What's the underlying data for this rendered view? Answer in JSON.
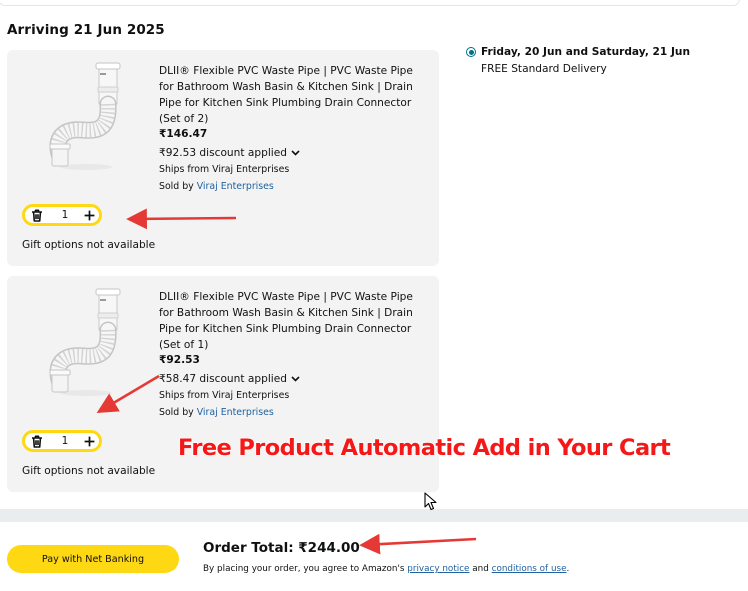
{
  "heading": "Arriving 21 Jun 2025",
  "items": [
    {
      "title": "DLII® Flexible PVC Waste Pipe | PVC Waste Pipe for Bathroom Wash Basin & Kitchen Sink | Drain Pipe for Kitchen Sink Plumbing Drain Connector (Set of 2)",
      "price": "₹146.47",
      "discount": "₹92.53 discount applied",
      "ships_from": "Ships from Viraj Enterprises",
      "sold_by_prefix": "Sold by ",
      "seller": "Viraj Enterprises",
      "quantity": "1",
      "gift": "Gift options not available"
    },
    {
      "title": "DLII® Flexible PVC Waste Pipe | PVC Waste Pipe for Bathroom Wash Basin & Kitchen Sink | Drain Pipe for Kitchen Sink Plumbing Drain Connector (Set of 1)",
      "price": "₹92.53",
      "discount": "₹58.47 discount applied",
      "ships_from": "Ships from Viraj Enterprises",
      "sold_by_prefix": "Sold by ",
      "seller": "Viraj Enterprises",
      "quantity": "1",
      "gift": "Gift options not available"
    }
  ],
  "delivery": {
    "date": "Friday, 20 Jun and Saturday, 21 Jun",
    "type": "FREE Standard Delivery",
    "selected": true
  },
  "footer": {
    "pay_button": "Pay with Net Banking",
    "order_total": "Order Total: ₹244.00",
    "legal_prefix": "By placing your order, you agree to Amazon's ",
    "privacy_link": "privacy notice",
    "legal_and": " and ",
    "conditions_link": "conditions of use",
    "legal_suffix": "."
  },
  "annotation": {
    "caption": "Free Product Automatic Add in Your Cart",
    "arrow_color": "#e53935"
  },
  "colors": {
    "pay_button": "#ffd814",
    "link": "#2162a1",
    "card_background": "#f3f3f3",
    "radio": "#007185",
    "caption_fill": "#f51818"
  },
  "icons": [
    "trash-icon",
    "plus-icon",
    "chevron-down-icon",
    "radio-button",
    "cursor-icon",
    "pipe-product-image"
  ]
}
